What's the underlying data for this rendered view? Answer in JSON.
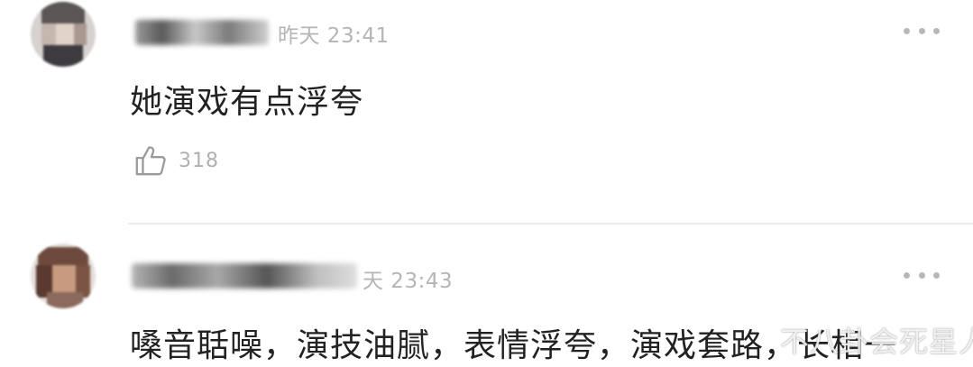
{
  "comments": [
    {
      "time": "昨天 23:41",
      "content": "她演戏有点浮夸",
      "likes": "318"
    },
    {
      "time": "天 23:43",
      "content": "嗓音聒噪，演技油腻，表情浮夸，演戏套路，长相一"
    }
  ],
  "icons": {
    "like": "thumbs-up-icon",
    "more": "more-dots-icon"
  },
  "watermark": "不八卦会死星人",
  "colors": {
    "muted_text": "#b5b5b5",
    "body_text": "#222222",
    "divider": "#ececec"
  }
}
